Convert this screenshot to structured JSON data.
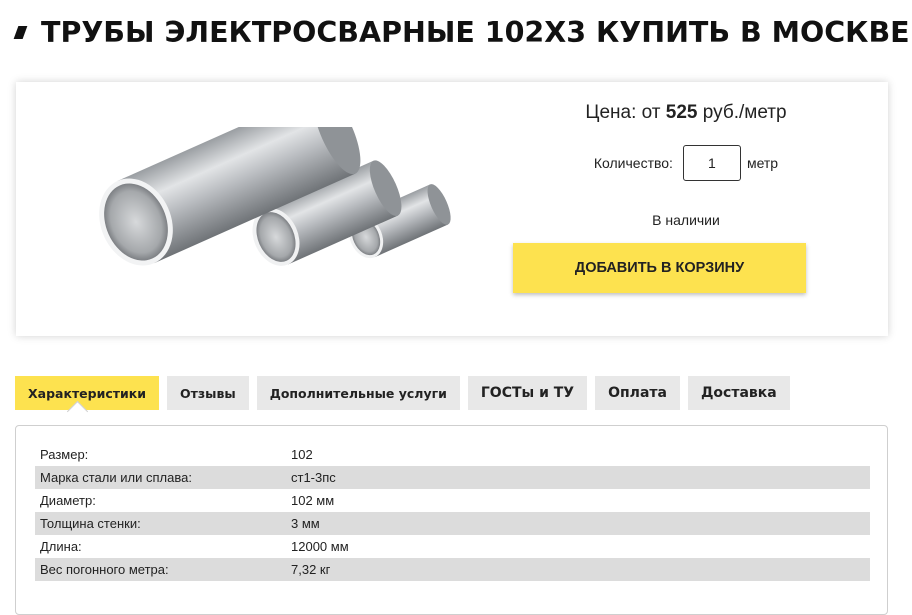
{
  "header": {
    "title": "ТРУБЫ ЭЛЕКТРОСВАРНЫЕ 102Х3 КУПИТЬ В МОСКВЕ"
  },
  "product": {
    "image_icon": "steel-pipes-image",
    "price_prefix": "Цена: от ",
    "price_value": "525",
    "price_suffix": " руб./метр",
    "quantity_label": "Количество:",
    "quantity_value": "1",
    "quantity_unit": "метр",
    "availability": "В наличии",
    "add_to_cart_label": "ДОБАВИТЬ В КОРЗИНУ"
  },
  "tabs": [
    {
      "label": "Характеристики",
      "active": true
    },
    {
      "label": "Отзывы",
      "active": false
    },
    {
      "label": "Дополнительные услуги",
      "active": false
    },
    {
      "label": "ГОСТы и ТУ",
      "active": false
    },
    {
      "label": "Оплата",
      "active": false
    },
    {
      "label": "Доставка",
      "active": false
    }
  ],
  "specs": [
    {
      "key": "Размер:",
      "value": "102"
    },
    {
      "key": "Марка стали или сплава:",
      "value": "ст1-3пс"
    },
    {
      "key": "Диаметр:",
      "value": "102 мм"
    },
    {
      "key": "Толщина стенки:",
      "value": "3 мм"
    },
    {
      "key": "Длина:",
      "value": "12000 мм"
    },
    {
      "key": "Вес погонного метра:",
      "value": "7,32 кг"
    }
  ],
  "colors": {
    "accent_yellow": "#fde24f",
    "tab_gray": "#e8e8e8",
    "stripe_gray": "#dcdcdc",
    "text_dark": "#111111"
  }
}
